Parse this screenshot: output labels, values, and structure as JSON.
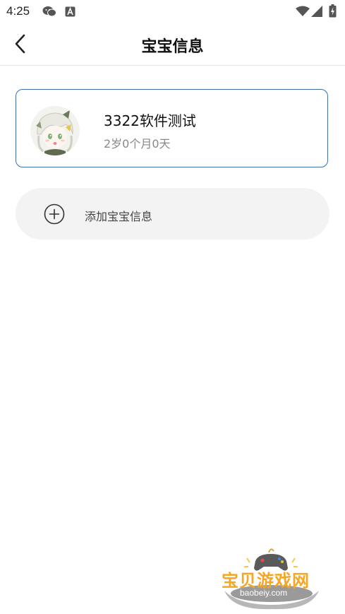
{
  "status_bar": {
    "time": "4:25"
  },
  "header": {
    "title": "宝宝信息"
  },
  "baby_card": {
    "name": "3322软件测试",
    "age": "2岁0个月0天"
  },
  "add_baby": {
    "label": "添加宝宝信息"
  },
  "watermark": {
    "title": "宝贝游戏网",
    "subtitle": "baobeiy.com"
  },
  "colors": {
    "card_border": "#3c6fa5",
    "add_button_bg": "#f3f3f3",
    "watermark_orange": "#f5a623"
  }
}
